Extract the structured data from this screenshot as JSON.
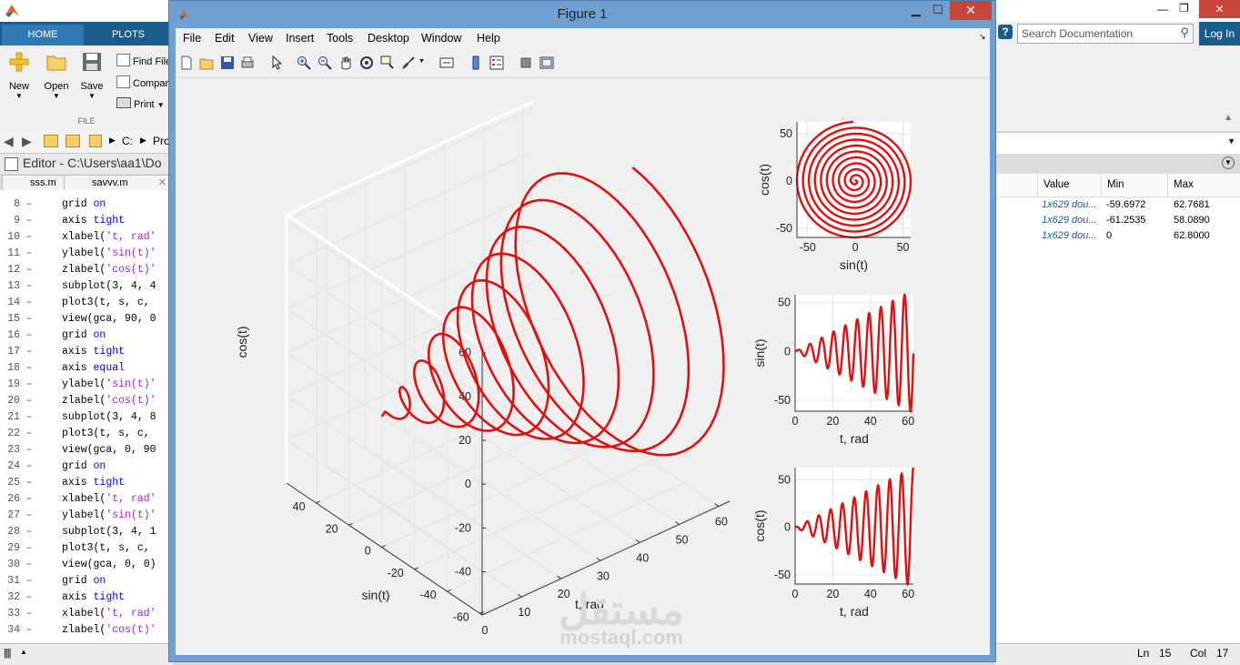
{
  "matlab": {
    "tabs": [
      "HOME",
      "PLOTS"
    ],
    "toolstrip": {
      "new_label": "New",
      "open_label": "Open",
      "save_label": "Save",
      "find_files_label": "Find File",
      "compare_label": "Compar",
      "print_label": "Print",
      "section_label": "FILE"
    },
    "address": {
      "crumbs": [
        "C:",
        "Pro"
      ]
    },
    "editor": {
      "title": "Editor - C:\\Users\\aa1\\Do",
      "tabs": [
        "sss.m",
        "savvv.m"
      ]
    },
    "code_lines": [
      {
        "n": "8",
        "parts": [
          [
            "",
            "grid "
          ],
          [
            "kw",
            "on"
          ]
        ]
      },
      {
        "n": "9",
        "parts": [
          [
            "",
            "axis "
          ],
          [
            "kw",
            "tight"
          ]
        ]
      },
      {
        "n": "10",
        "parts": [
          [
            "",
            "xlabel("
          ],
          [
            "str",
            "'t, rad'"
          ]
        ]
      },
      {
        "n": "11",
        "parts": [
          [
            "",
            "ylabel("
          ],
          [
            "str",
            "'sin(t)'"
          ]
        ]
      },
      {
        "n": "12",
        "parts": [
          [
            "",
            "zlabel("
          ],
          [
            "str",
            "'cos(t)'"
          ]
        ]
      },
      {
        "n": "13",
        "parts": [
          [
            "",
            "subplot(3, 4, 4"
          ]
        ]
      },
      {
        "n": "14",
        "parts": [
          [
            "",
            "plot3(t, s, c,"
          ]
        ]
      },
      {
        "n": "15",
        "parts": [
          [
            "",
            "view(gca, 90, 0"
          ]
        ]
      },
      {
        "n": "16",
        "parts": [
          [
            "",
            "grid "
          ],
          [
            "kw",
            "on"
          ]
        ]
      },
      {
        "n": "17",
        "parts": [
          [
            "",
            "axis "
          ],
          [
            "kw",
            "tight"
          ]
        ]
      },
      {
        "n": "18",
        "parts": [
          [
            "",
            "axis "
          ],
          [
            "kw",
            "equal"
          ]
        ]
      },
      {
        "n": "19",
        "parts": [
          [
            "",
            "ylabel("
          ],
          [
            "str",
            "'sin(t)'"
          ]
        ]
      },
      {
        "n": "20",
        "parts": [
          [
            "",
            "zlabel("
          ],
          [
            "str",
            "'cos(t)'"
          ]
        ]
      },
      {
        "n": "21",
        "parts": [
          [
            "",
            "subplot(3, 4, 8"
          ]
        ]
      },
      {
        "n": "22",
        "parts": [
          [
            "",
            "plot3(t, s, c,"
          ]
        ]
      },
      {
        "n": "23",
        "parts": [
          [
            "",
            "view(gca, 0, 90"
          ]
        ]
      },
      {
        "n": "24",
        "parts": [
          [
            "",
            "grid "
          ],
          [
            "kw",
            "on"
          ]
        ]
      },
      {
        "n": "25",
        "parts": [
          [
            "",
            "axis "
          ],
          [
            "kw",
            "tight"
          ]
        ]
      },
      {
        "n": "26",
        "parts": [
          [
            "",
            "xlabel("
          ],
          [
            "str",
            "'t, rad'"
          ]
        ]
      },
      {
        "n": "27",
        "parts": [
          [
            "",
            "ylabel("
          ],
          [
            "str",
            "'sin(t)'"
          ]
        ]
      },
      {
        "n": "28",
        "parts": [
          [
            "",
            "subplot(3, 4, 1"
          ]
        ]
      },
      {
        "n": "29",
        "parts": [
          [
            "",
            "plot3(t, s, c,"
          ]
        ]
      },
      {
        "n": "30",
        "parts": [
          [
            "",
            "view(gca, 0, 0)"
          ]
        ]
      },
      {
        "n": "31",
        "parts": [
          [
            "",
            "grid "
          ],
          [
            "kw",
            "on"
          ]
        ]
      },
      {
        "n": "32",
        "parts": [
          [
            "",
            "axis "
          ],
          [
            "kw",
            "tight"
          ]
        ]
      },
      {
        "n": "33",
        "parts": [
          [
            "",
            "xlabel("
          ],
          [
            "str",
            "'t, rad'"
          ]
        ]
      },
      {
        "n": "34",
        "parts": [
          [
            "",
            "zlabel("
          ],
          [
            "str",
            "'cos(t)'"
          ]
        ]
      }
    ],
    "search_placeholder": "Search Documentation",
    "login_label": "Log In",
    "workspace": {
      "columns": [
        "Value",
        "Min",
        "Max"
      ],
      "rows": [
        {
          "value": "1x629 dou...",
          "min": "-59.6972",
          "max": "62.7681"
        },
        {
          "value": "1x629 dou...",
          "min": "-61.2535",
          "max": "58.0890"
        },
        {
          "value": "1x629 dou...",
          "min": "0",
          "max": "62.8000"
        }
      ]
    },
    "status": {
      "ln_label": "Ln",
      "ln": "15",
      "col_label": "Col",
      "col": "17"
    }
  },
  "figure": {
    "title": "Figure 1",
    "menus": [
      "File",
      "Edit",
      "View",
      "Insert",
      "Tools",
      "Desktop",
      "Window",
      "Help"
    ],
    "watermark": {
      "arabic": "مستقل",
      "latin": "mostaql.com"
    },
    "line_color": "#e01010"
  },
  "chart_data": [
    {
      "type": "line3d",
      "description_role": "main 3D helix plot3(t, sin-ish, cos-ish)",
      "xlabel": "t, rad",
      "ylabel": "sin(t)",
      "zlabel": "cos(t)",
      "xticks": [
        "0",
        "10",
        "20",
        "30",
        "40",
        "50",
        "60"
      ],
      "yticks": [
        "-60",
        "-40",
        "-20",
        "0",
        "20",
        "40"
      ],
      "zticks": [
        "-40",
        "-20",
        "0",
        "20",
        "40",
        "60"
      ],
      "xlim": [
        0,
        62.8
      ],
      "ylim": [
        -61.25,
        58.09
      ],
      "zlim": [
        -59.7,
        62.77
      ],
      "grid": true
    },
    {
      "type": "line",
      "view": "sin vs cos (spiral)",
      "xlabel": "sin(t)",
      "ylabel": "cos(t)",
      "xticks": [
        "-50",
        "0",
        "50"
      ],
      "yticks": [
        "50",
        "0",
        "-50"
      ],
      "xlim": [
        -61.25,
        58.09
      ],
      "ylim": [
        -59.7,
        62.77
      ],
      "grid": true
    },
    {
      "type": "line",
      "view": "t vs sin(t)",
      "xlabel": "t, rad",
      "ylabel": "sin(t)",
      "xticks": [
        "0",
        "20",
        "40",
        "60"
      ],
      "yticks": [
        "50",
        "0",
        "-50"
      ],
      "xlim": [
        0,
        62.8
      ],
      "ylim": [
        -61.25,
        58.09
      ],
      "grid": true
    },
    {
      "type": "line",
      "view": "t vs cos(t)",
      "xlabel": "t, rad",
      "ylabel": "cos(t)",
      "xticks": [
        "0",
        "20",
        "40",
        "60"
      ],
      "yticks": [
        "50",
        "0",
        "-50"
      ],
      "xlim": [
        0,
        62.8
      ],
      "ylim": [
        -59.7,
        62.77
      ],
      "grid": true
    }
  ]
}
